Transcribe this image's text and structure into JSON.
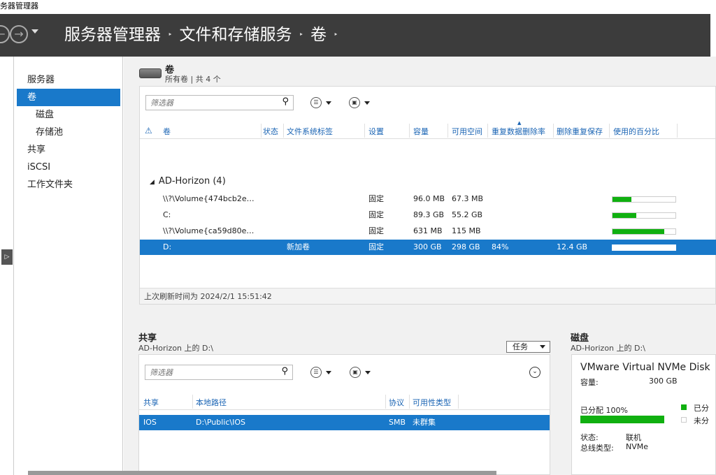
{
  "window": {
    "title": "务器管理器"
  },
  "header": {
    "back_icon": "back-arrow-icon",
    "forward_icon": "forward-arrow-icon",
    "breadcrumb": [
      "服务器管理器",
      "文件和存储服务",
      "卷"
    ],
    "sep": "‣"
  },
  "sidebar": {
    "items": [
      {
        "label": "服务器"
      },
      {
        "label": "卷"
      },
      {
        "label": "磁盘"
      },
      {
        "label": "存储池"
      },
      {
        "label": "共享"
      },
      {
        "label": "iSCSI"
      },
      {
        "label": "工作文件夹"
      }
    ],
    "active_index": 1
  },
  "volumes": {
    "title": "卷",
    "subtitle": "所有卷 | 共 4 个",
    "filter_placeholder": "筛选器",
    "columns": [
      "卷",
      "状态",
      "文件系统标签",
      "设置",
      "容量",
      "可用空间",
      "重复数据删除率",
      "删除重复保存",
      "使用的百分比"
    ],
    "group": "AD-Horizon (4)",
    "rows": [
      {
        "name": "\\\\?\\Volume{474bcb2e…",
        "status": "",
        "label": "",
        "setting": "固定",
        "capacity": "96.0 MB",
        "free": "67.3 MB",
        "dedup_rate": "",
        "dedup_saved": "",
        "used_pct": 30
      },
      {
        "name": "C:",
        "status": "",
        "label": "",
        "setting": "固定",
        "capacity": "89.3 GB",
        "free": "55.2 GB",
        "dedup_rate": "",
        "dedup_saved": "",
        "used_pct": 38
      },
      {
        "name": "\\\\?\\Volume{ca59d80e…",
        "status": "",
        "label": "",
        "setting": "固定",
        "capacity": "631 MB",
        "free": "115 MB",
        "dedup_rate": "",
        "dedup_saved": "",
        "used_pct": 82
      },
      {
        "name": "D:",
        "status": "",
        "label": "新加卷",
        "setting": "固定",
        "capacity": "300 GB",
        "free": "298 GB",
        "dedup_rate": "84%",
        "dedup_saved": "12.4 GB",
        "used_pct": 1
      }
    ],
    "selected_index": 3,
    "refresh_text": "上次刷新时间为 2024/2/1 15:51:42"
  },
  "shares": {
    "title": "共享",
    "subtitle": "AD-Horizon 上的 D:\\",
    "tasks_label": "任务",
    "filter_placeholder": "筛选器",
    "columns": [
      "共享",
      "本地路径",
      "协议",
      "可用性类型"
    ],
    "rows": [
      {
        "share": "IOS",
        "path": "D:\\Public\\IOS",
        "protocol": "SMB",
        "availability": "未群集"
      }
    ]
  },
  "disk": {
    "title": "磁盘",
    "subtitle": "AD-Horizon 上的 D:\\",
    "name": "VMware Virtual NVMe Disk",
    "capacity_label": "容量:",
    "capacity_value": "300 GB",
    "allocated_label": "已分配 100%",
    "allocated_pct": 100,
    "legend_allocated": "已分",
    "legend_unallocated": "未分",
    "status_label": "状态:",
    "status_value": "联机",
    "bus_label": "总线类型:",
    "bus_value": "NVMe",
    "colors": {
      "allocated": "#10b010",
      "unallocated": "#e8e8e8"
    }
  },
  "colors": {
    "accent": "#1979ca",
    "header_bg": "#3c3c3c",
    "bar_green": "#10b010"
  }
}
